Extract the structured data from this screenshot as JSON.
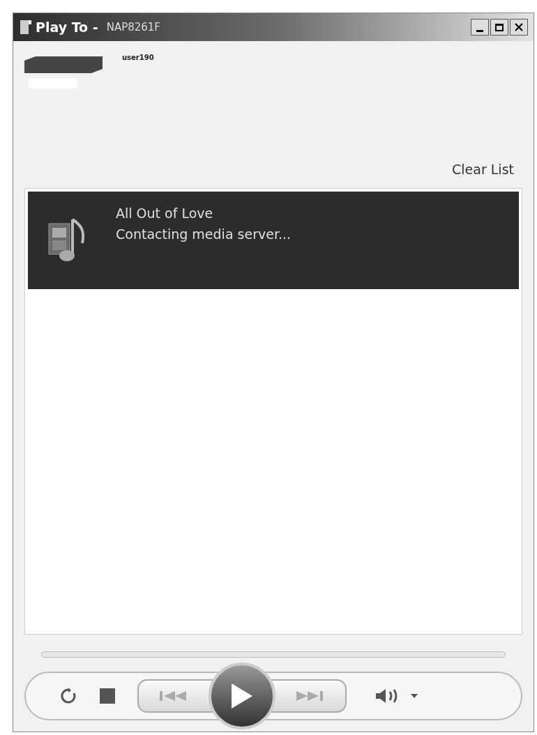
{
  "window": {
    "title": "Play To -",
    "device_name": "NAP8261F"
  },
  "device": {
    "label": "user190"
  },
  "clear_list": "Clear List",
  "playlist": [
    {
      "title": "All Out of Love",
      "status": "Contacting media server...",
      "selected": true
    }
  ]
}
